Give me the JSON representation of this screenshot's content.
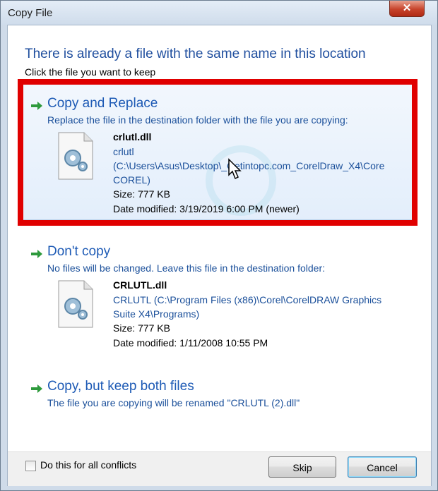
{
  "window": {
    "title": "Copy File",
    "close_label": "✕"
  },
  "header": {
    "heading": "There is already a file with the same name in this location",
    "instruction": "Click the file you want to keep"
  },
  "options": {
    "replace": {
      "title": "Copy and Replace",
      "description": "Replace the file in the destination folder with the file you are copying:",
      "file": {
        "name": "crlutl.dll",
        "line1": "crlutl",
        "line2": "(C:\\Users\\Asus\\Desktop\\_Getintopc.com_CorelDraw_X4\\Core",
        "line3": "COREL)",
        "size": "Size: 777 KB",
        "date": "Date modified: 3/19/2019 6:00 PM (newer)"
      }
    },
    "dont_copy": {
      "title": "Don't copy",
      "description": "No files will be changed. Leave this file in the destination folder:",
      "file": {
        "name": "CRLUTL.dll",
        "line1": "CRLUTL (C:\\Program Files (x86)\\Corel\\CorelDRAW Graphics",
        "line2": "Suite X4\\Programs)",
        "size": "Size: 777 KB",
        "date": "Date modified: 1/11/2008 10:55 PM"
      }
    },
    "keep_both": {
      "title": "Copy, but keep both files",
      "description": "The file you are copying will be renamed \"CRLUTL (2).dll\""
    }
  },
  "footer": {
    "checkbox_label": "Do this for all conflicts",
    "skip_label": "Skip",
    "cancel_label": "Cancel"
  },
  "colors": {
    "accent": "#1d5ab5",
    "highlight": "#e00000",
    "arrow": "#2e9a3c"
  }
}
